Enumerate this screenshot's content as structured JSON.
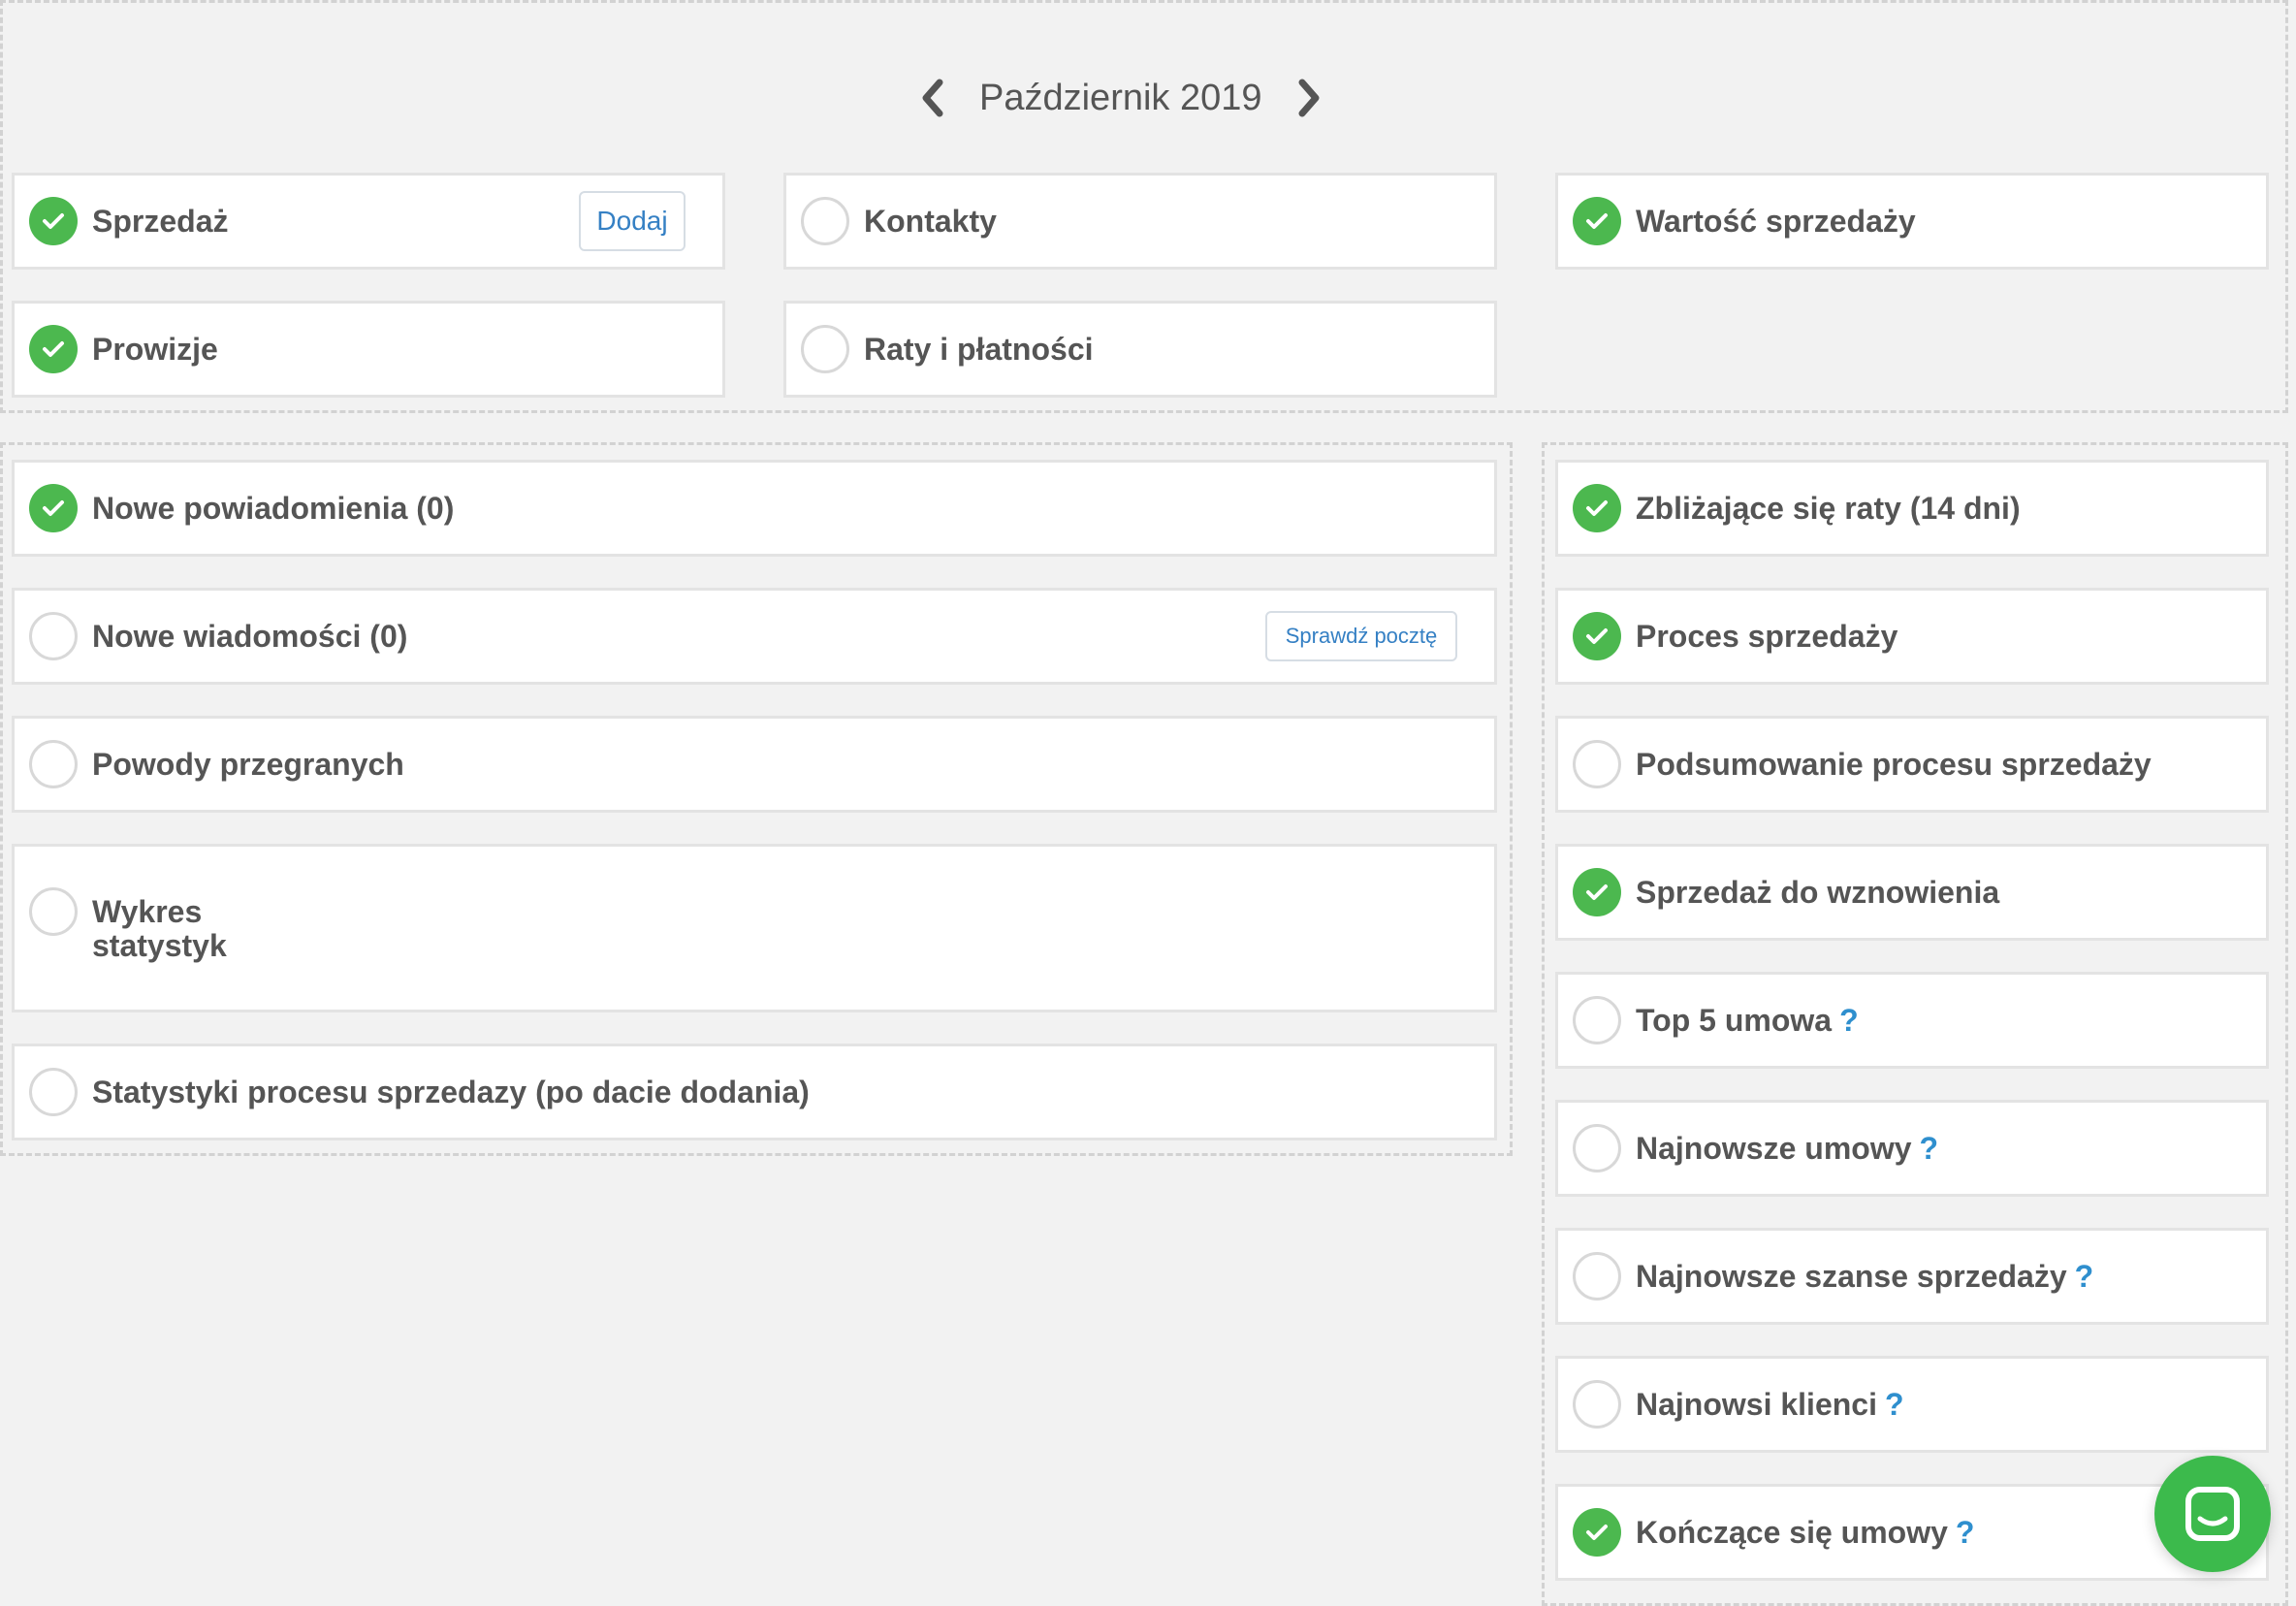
{
  "header": {
    "month_label": "Październik 2019"
  },
  "colors": {
    "check_green": "#4cb84f",
    "help_blue": "#2f8fce",
    "chat_green": "#3cba4c"
  },
  "top_widgets": {
    "sprzedaz": {
      "label": "Sprzedaż",
      "checked": true,
      "button": "Dodaj"
    },
    "kontakty": {
      "label": "Kontakty",
      "checked": false
    },
    "wartosc": {
      "label": "Wartość sprzedaży",
      "checked": true
    },
    "prowizje": {
      "label": "Prowizje",
      "checked": true
    },
    "raty": {
      "label": "Raty i płatności",
      "checked": false
    }
  },
  "left_widgets": {
    "powiadomienia": {
      "label": "Nowe powiadomienia (0)",
      "checked": true
    },
    "wiadomosci": {
      "label": "Nowe wiadomości (0)",
      "checked": false,
      "button": "Sprawdź pocztę"
    },
    "powody": {
      "label": "Powody przegranych",
      "checked": false
    },
    "wykres": {
      "label": "Wykres statystyk",
      "checked": false
    },
    "statystyki": {
      "label": "Statystyki procesu sprzedazy (po dacie dodania)",
      "checked": false
    }
  },
  "right_widgets": {
    "zblizajace": {
      "label": "Zbliżające się raty (14 dni)",
      "checked": true
    },
    "proces": {
      "label": "Proces sprzedaży",
      "checked": true
    },
    "podsumowanie": {
      "label": "Podsumowanie procesu sprzedaży",
      "checked": false
    },
    "wznowienia": {
      "label": "Sprzedaż do wznowienia",
      "checked": true
    },
    "top5": {
      "label": "Top 5 umowa",
      "checked": false,
      "help": "?"
    },
    "umowy": {
      "label": "Najnowsze umowy",
      "checked": false,
      "help": "?"
    },
    "szanse": {
      "label": "Najnowsze szanse sprzedaży",
      "checked": false,
      "help": "?"
    },
    "klienci": {
      "label": "Najnowsi klienci",
      "checked": false,
      "help": "?"
    },
    "konczace": {
      "label": "Kończące się umowy",
      "checked": true,
      "help": "?"
    }
  }
}
